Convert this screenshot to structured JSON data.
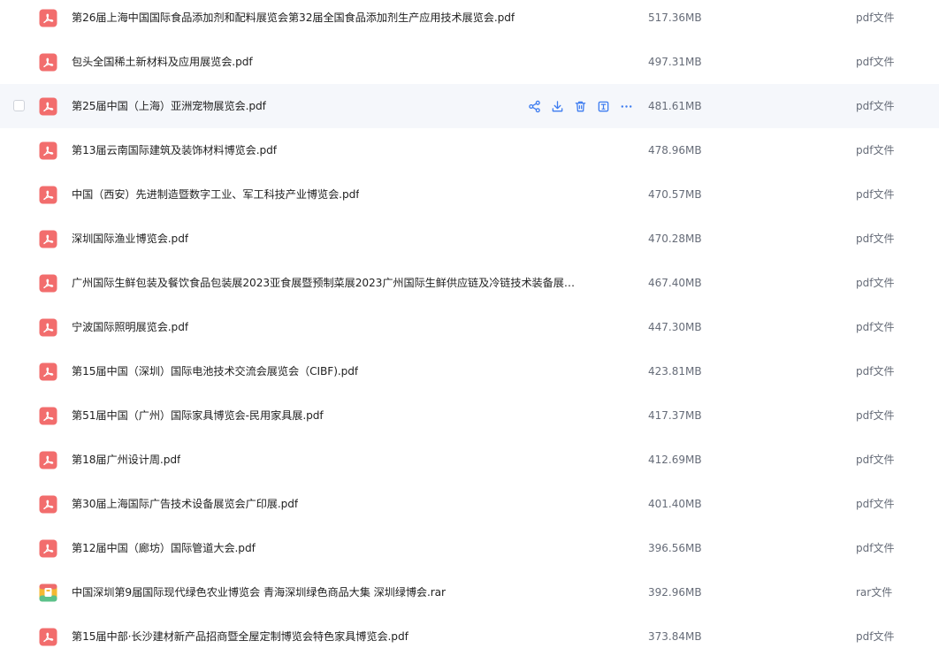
{
  "colors": {
    "pdf_icon": "#f26d6d",
    "action_icon": "#3d7cf0",
    "hover_row": "#f5f7fb"
  },
  "actions": [
    {
      "name": "share-icon"
    },
    {
      "name": "download-icon"
    },
    {
      "name": "delete-icon"
    },
    {
      "name": "rename-icon"
    },
    {
      "name": "more-icon"
    }
  ],
  "files": [
    {
      "name": "第26届上海中国国际食品添加剂和配料展览会第32届全国食品添加剂生产应用技术展览会.pdf",
      "size": "517.36MB",
      "type": "pdf文件",
      "icon": "pdf-icon"
    },
    {
      "name": "包头全国稀土新材料及应用展览会.pdf",
      "size": "497.31MB",
      "type": "pdf文件",
      "icon": "pdf-icon"
    },
    {
      "name": "第25届中国（上海）亚洲宠物展览会.pdf",
      "size": "481.61MB",
      "type": "pdf文件",
      "icon": "pdf-icon",
      "hovered": true
    },
    {
      "name": "第13届云南国际建筑及装饰材料博览会.pdf",
      "size": "478.96MB",
      "type": "pdf文件",
      "icon": "pdf-icon"
    },
    {
      "name": "中国（西安）先进制造暨数字工业、军工科技产业博览会.pdf",
      "size": "470.57MB",
      "type": "pdf文件",
      "icon": "pdf-icon"
    },
    {
      "name": "深圳国际渔业博览会.pdf",
      "size": "470.28MB",
      "type": "pdf文件",
      "icon": "pdf-icon"
    },
    {
      "name": "广州国际生鲜包装及餐饮食品包装展2023亚食展暨预制菜展2023广州国际生鲜供应链及冷链技术装备展览...",
      "size": "467.40MB",
      "type": "pdf文件",
      "icon": "pdf-icon"
    },
    {
      "name": "宁波国际照明展览会.pdf",
      "size": "447.30MB",
      "type": "pdf文件",
      "icon": "pdf-icon"
    },
    {
      "name": "第15届中国（深圳）国际电池技术交流会展览会（CIBF).pdf",
      "size": "423.81MB",
      "type": "pdf文件",
      "icon": "pdf-icon"
    },
    {
      "name": "第51届中国（广州）国际家具博览会-民用家具展.pdf",
      "size": "417.37MB",
      "type": "pdf文件",
      "icon": "pdf-icon"
    },
    {
      "name": "第18届广州设计周.pdf",
      "size": "412.69MB",
      "type": "pdf文件",
      "icon": "pdf-icon"
    },
    {
      "name": "第30届上海国际广告技术设备展览会广印展.pdf",
      "size": "401.40MB",
      "type": "pdf文件",
      "icon": "pdf-icon"
    },
    {
      "name": "第12届中国（廊坊）国际管道大会.pdf",
      "size": "396.56MB",
      "type": "pdf文件",
      "icon": "pdf-icon"
    },
    {
      "name": "中国深圳第9届国际现代绿色农业博览会 青海深圳绿色商品大集 深圳绿博会.rar",
      "size": "392.96MB",
      "type": "rar文件",
      "icon": "rar-icon"
    },
    {
      "name": "第15届中部·长沙建材新产品招商暨全屋定制博览会特色家具博览会.pdf",
      "size": "373.84MB",
      "type": "pdf文件",
      "icon": "pdf-icon"
    }
  ]
}
